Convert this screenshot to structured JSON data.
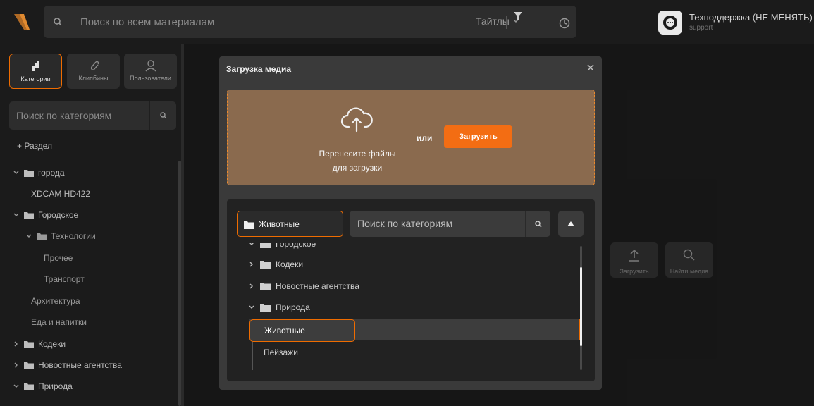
{
  "topbar": {
    "search_placeholder": "Поиск по всем материалам",
    "title_filter": "Тайтлы",
    "support_name": "Техподдержка (НЕ МЕНЯТЬ)",
    "support_login": "support"
  },
  "sidebar": {
    "tabs": [
      {
        "label": "Категории",
        "icon": "categories-icon",
        "active": true
      },
      {
        "label": "Клипбины",
        "icon": "paperclip-icon",
        "active": false
      },
      {
        "label": "Пользователи",
        "icon": "user-icon",
        "active": false
      }
    ],
    "search_placeholder": "Поиск по категориям",
    "add_section": "+ Раздел",
    "tree": [
      {
        "label": "города",
        "level": 0,
        "expanded": true,
        "folder": true
      },
      {
        "label": "XDCAM HD422",
        "level": 1,
        "folder": false
      },
      {
        "label": "Городское",
        "level": 0,
        "expanded": true,
        "folder": true
      },
      {
        "label": "Технологии",
        "level": 1,
        "expanded": true,
        "folder": true
      },
      {
        "label": "Прочее",
        "level": 2,
        "folder": false
      },
      {
        "label": "Транспорт",
        "level": 2,
        "folder": false
      },
      {
        "label": "Архитектура",
        "level": 1,
        "folder": false
      },
      {
        "label": "Еда и напитки",
        "level": 1,
        "folder": false
      },
      {
        "label": "Кодеки",
        "level": 0,
        "expanded": false,
        "folder": true
      },
      {
        "label": "Новостные агентства",
        "level": 0,
        "expanded": false,
        "folder": true
      },
      {
        "label": "Природа",
        "level": 0,
        "expanded": true,
        "folder": true
      }
    ]
  },
  "tools": {
    "upload_label": "Загрузить",
    "find_label": "Найти медиа"
  },
  "modal": {
    "title": "Загрузка медиа",
    "drop_text_line1": "Перенесите файлы",
    "drop_text_line2": "для загрузки",
    "or_text": "или",
    "upload_button": "Загрузить",
    "selected_category": "Животные",
    "cat_search_placeholder": "Поиск по категориям",
    "tree": [
      {
        "label": "Городское",
        "level": 0,
        "expanded": true,
        "folder": true
      },
      {
        "label": "Кодеки",
        "level": 0,
        "expanded": false,
        "folder": true
      },
      {
        "label": "Новостные агентства",
        "level": 0,
        "expanded": false,
        "folder": true
      },
      {
        "label": "Природа",
        "level": 0,
        "expanded": true,
        "folder": true
      },
      {
        "label": "Животные",
        "level": 1,
        "selected": true,
        "folder": false
      },
      {
        "label": "Пейзажи",
        "level": 1,
        "folder": false
      }
    ]
  },
  "colors": {
    "accent": "#ef6c00",
    "upload_button": "#f36d13",
    "dropzone_bg": "#8a6a4e"
  }
}
